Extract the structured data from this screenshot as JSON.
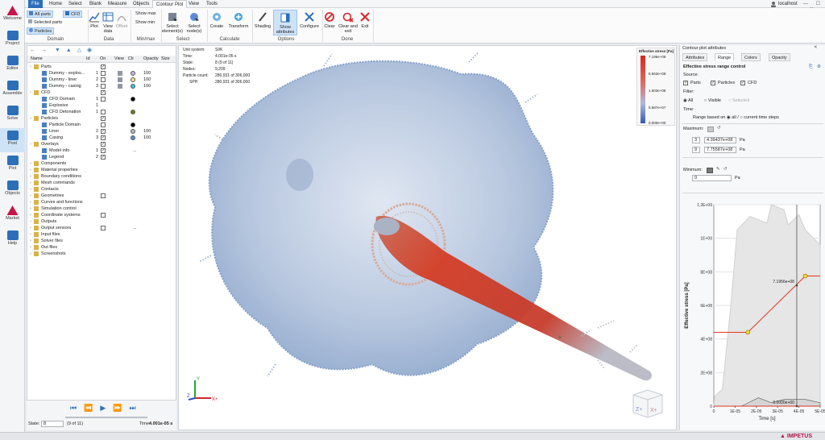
{
  "rail": [
    {
      "icon": "welcome-icon",
      "label": "Welcome",
      "active": false
    },
    {
      "icon": "project-icon",
      "label": "Project",
      "active": false
    },
    {
      "icon": "editor-icon",
      "label": "Editor",
      "active": false
    },
    {
      "icon": "assemble-icon",
      "label": "Assemble",
      "active": false
    },
    {
      "icon": "solve-icon",
      "label": "Solve",
      "active": false
    },
    {
      "icon": "post-icon",
      "label": "Post",
      "active": true
    },
    {
      "icon": "plot-icon",
      "label": "Plot",
      "active": false
    },
    {
      "icon": "objects-icon",
      "label": "Objects",
      "active": false
    },
    {
      "icon": "market-icon",
      "label": "Market",
      "active": false
    },
    {
      "icon": "help-icon",
      "label": "Help",
      "active": false
    }
  ],
  "menu": [
    "File",
    "Home",
    "Select",
    "Blank",
    "Measure",
    "Objects",
    "Contour Plot",
    "View",
    "Tools"
  ],
  "menu_active": "Contour Plot",
  "host": "localhost",
  "ribbon": {
    "domain": {
      "all_parts": "All parts",
      "cfd": "CFD",
      "selected_parts": "Selected parts",
      "particles": "Particles",
      "label": "Domain"
    },
    "data": {
      "plot": "Plot",
      "view_data": "View data",
      "offset": "Offset",
      "label": "Data"
    },
    "minmax": {
      "show_max": "Show max",
      "show_min": "Show min",
      "label": "Min/max"
    },
    "select": {
      "select_elements": "Select element(s)",
      "select_nodes": "Select node(s)",
      "label": "Select"
    },
    "calculate": {
      "create": "Create",
      "transform": "Transform",
      "label": "Calculate"
    },
    "options": {
      "shading": "Shading",
      "show_attributes": "Show attributes",
      "configure": "Configure",
      "label": "Options"
    },
    "done": {
      "clear": "Clear",
      "clear_and_exit": "Clear and exit",
      "exit": "Exit",
      "label": "Done"
    }
  },
  "tree": {
    "columns": [
      "Name",
      "Id",
      "On",
      "View",
      "Clr",
      "Opacity",
      "Size"
    ],
    "rows": [
      {
        "name": "Parts",
        "indent": 0,
        "id": "",
        "on": true,
        "clr": "",
        "opacity": "",
        "size": ""
      },
      {
        "name": "Dummy - explos...",
        "indent": 1,
        "id": "1",
        "on": false,
        "clr": "#c9b3e6",
        "opacity": "100",
        "size": ""
      },
      {
        "name": "Dummy - liner",
        "indent": 1,
        "id": "2",
        "on": false,
        "clr": "#f5e27a",
        "opacity": "100",
        "size": ""
      },
      {
        "name": "Dummy - casing",
        "indent": 1,
        "id": "3",
        "on": false,
        "clr": "#39c3dc",
        "opacity": "100",
        "size": ""
      },
      {
        "name": "CFD",
        "indent": 0,
        "id": "",
        "on": true,
        "clr": "",
        "opacity": "",
        "size": ""
      },
      {
        "name": "CFD Domain",
        "indent": 1,
        "id": "1",
        "on": false,
        "clr": "#000000",
        "opacity": "",
        "size": ""
      },
      {
        "name": "Explosive",
        "indent": 1,
        "id": "1",
        "on": null,
        "clr": "",
        "opacity": "",
        "size": ""
      },
      {
        "name": "CFD Detonation",
        "indent": 1,
        "id": "1",
        "on": false,
        "clr": "#7a7a1e",
        "opacity": "",
        "size": ""
      },
      {
        "name": "Particles",
        "indent": 0,
        "id": "",
        "on": true,
        "clr": "",
        "opacity": "",
        "size": ""
      },
      {
        "name": "Particle Domain",
        "indent": 1,
        "id": "",
        "on": false,
        "clr": "#000000",
        "opacity": "",
        "size": ""
      },
      {
        "name": "Liner",
        "indent": 1,
        "id": "2",
        "on": true,
        "clr": "#b0b8c8",
        "opacity": "100",
        "size": ""
      },
      {
        "name": "Casing",
        "indent": 1,
        "id": "3",
        "on": true,
        "clr": "#5b8bd8",
        "opacity": "100",
        "size": ""
      },
      {
        "name": "Overlays",
        "indent": 0,
        "id": "",
        "on": true,
        "clr": "",
        "opacity": "",
        "size": ""
      },
      {
        "name": "Model info",
        "indent": 1,
        "id": "1",
        "on": true,
        "clr": "",
        "opacity": "",
        "size": "..."
      },
      {
        "name": "Legend",
        "indent": 1,
        "id": "2",
        "on": true,
        "clr": "",
        "opacity": "",
        "size": ""
      },
      {
        "name": "Components",
        "indent": 0,
        "id": "",
        "on": null,
        "clr": "",
        "opacity": "",
        "size": ""
      },
      {
        "name": "Material properties",
        "indent": 0,
        "id": "",
        "on": null,
        "clr": "",
        "opacity": "",
        "size": ""
      },
      {
        "name": "Boundary conditions",
        "indent": 0,
        "id": "",
        "on": null,
        "clr": "",
        "opacity": "",
        "size": ""
      },
      {
        "name": "Mesh commands",
        "indent": 0,
        "id": "",
        "on": null,
        "clr": "",
        "opacity": "",
        "size": ""
      },
      {
        "name": "Contacts",
        "indent": 0,
        "id": "",
        "on": null,
        "clr": "",
        "opacity": "",
        "size": ""
      },
      {
        "name": "Geometries",
        "indent": 0,
        "id": "",
        "on": false,
        "clr": "",
        "opacity": "",
        "size": ""
      },
      {
        "name": "Curves and functions",
        "indent": 0,
        "id": "",
        "on": null,
        "clr": "",
        "opacity": "",
        "size": ""
      },
      {
        "name": "Simulation control",
        "indent": 0,
        "id": "",
        "on": null,
        "clr": "",
        "opacity": "",
        "size": ""
      },
      {
        "name": "Coordinate systems",
        "indent": 0,
        "id": "",
        "on": false,
        "clr": "",
        "opacity": "",
        "size": ""
      },
      {
        "name": "Outputs",
        "indent": 0,
        "id": "",
        "on": null,
        "clr": "",
        "opacity": "",
        "size": ""
      },
      {
        "name": "Output sensors",
        "indent": 0,
        "id": "",
        "on": false,
        "clr": "",
        "opacity": "",
        "size": "..."
      },
      {
        "name": "Input files",
        "indent": 0,
        "id": "",
        "on": null,
        "clr": "",
        "opacity": "",
        "size": ""
      },
      {
        "name": "Solver files",
        "indent": 0,
        "id": "",
        "on": null,
        "clr": "",
        "opacity": "",
        "size": ""
      },
      {
        "name": "Out files",
        "indent": 0,
        "id": "",
        "on": null,
        "clr": "",
        "opacity": "",
        "size": ""
      },
      {
        "name": "Screenshots",
        "indent": 0,
        "id": "",
        "on": null,
        "clr": "",
        "opacity": "",
        "size": ""
      }
    ]
  },
  "playback": {
    "state_label": "State:",
    "state_value": "8",
    "state_of": "(9 of 11)",
    "time_label": "Time:",
    "time_value": "4.001e-05 s"
  },
  "model_info": [
    {
      "k": "Unit system:",
      "v": "SI/K"
    },
    {
      "k": "Time:",
      "v": "4.001e-05 s"
    },
    {
      "k": "State:",
      "v": "8 (9 of 11)"
    },
    {
      "k": "Nodes:",
      "v": "9,209"
    },
    {
      "k": "Particle count:",
      "v": "280,931 of 306,000"
    },
    {
      "k": "SPH",
      "v": "280,931 of 306,000"
    }
  ],
  "legend": {
    "title": "Effective stress [Pa]",
    "ticks": [
      "7.196e+08",
      "5.553e+08",
      "1.603e+08",
      "5.587e+07",
      "0.000e+00"
    ]
  },
  "axes_triad": {
    "x": "X+",
    "y": "Y",
    "z": "Z"
  },
  "view_cube": {
    "face1": "Z+",
    "face2": "X+"
  },
  "rpanel": {
    "title": "Contour plot attributes",
    "tabs": [
      "Attributes",
      "Range",
      "Colors",
      "Opacity"
    ],
    "active_tab": "Range",
    "heading": "Effective stress range control",
    "source_label": "Source:",
    "sources": [
      {
        "label": "Parts",
        "checked": true
      },
      {
        "label": "Particles",
        "checked": true
      },
      {
        "label": "CFD",
        "checked": true
      }
    ],
    "filter_label": "Filter:",
    "filters": [
      "All",
      "Visible",
      "Selected"
    ],
    "filter_selected": "All",
    "time_label": "Time:",
    "range_based_on": "Range based on",
    "range_all": "all",
    "range_sep": "/",
    "range_current": "current time steps",
    "maximum_label": "Maximum:",
    "max_rows": [
      {
        "idx": "3",
        "value": "4.39437e+08",
        "unit": "Pa"
      },
      {
        "idx": "9",
        "value": "7.75587e+08",
        "unit": "Pa"
      }
    ],
    "minimum_label": "Minimum:",
    "min_row": {
      "value": "0",
      "unit": "Pa"
    }
  },
  "chart_data": {
    "type": "line",
    "xlabel": "Time [s]",
    "ylabel": "Effective stress [Pa]",
    "xlim": [
      0,
      5e-05
    ],
    "ylim": [
      0,
      1200000000
    ],
    "x_ticks": [
      "0",
      "1E-05",
      "2E-05",
      "3E-05",
      "4E-05",
      "5E-05"
    ],
    "y_ticks": [
      "0",
      "2E+08",
      "4E+08",
      "6E+08",
      "8E+08",
      "1E+09",
      "1.2E+09"
    ],
    "series": [
      {
        "values": [
          [
            0,
            440000000
          ],
          [
            1.6e-05,
            440000000
          ],
          [
            4.3e-05,
            775000000
          ],
          [
            5e-05,
            775000000
          ]
        ],
        "color": "#e0341e"
      },
      {
        "values": [
          [
            0,
            0
          ],
          [
            1.6e-05,
            0
          ],
          [
            5e-05,
            0
          ]
        ],
        "color": "#e0341e"
      }
    ],
    "envelope": [
      [
        0,
        0
      ],
      [
        5e-07,
        60000000
      ],
      [
        4e-06,
        100000000
      ],
      [
        8e-06,
        600000000
      ],
      [
        1.1e-05,
        1050000000
      ],
      [
        1.7e-05,
        1130000000
      ],
      [
        2.5e-05,
        1090000000
      ],
      [
        2.7e-05,
        1200000000
      ],
      [
        3.3e-05,
        1170000000
      ],
      [
        3.5e-05,
        1080000000
      ],
      [
        4e-05,
        1140000000
      ],
      [
        4.3e-05,
        1050000000
      ],
      [
        5e-05,
        960000000
      ]
    ],
    "low_envelope": [
      [
        0,
        0
      ],
      [
        1.3e-05,
        0
      ],
      [
        2.1e-05,
        50000000
      ],
      [
        2.7e-05,
        20000000
      ],
      [
        3.3e-05,
        40000000
      ],
      [
        4.3e-05,
        40000000
      ],
      [
        5e-05,
        20000000
      ]
    ],
    "markers": [
      [
        1.6e-05,
        440000000
      ],
      [
        4.3e-05,
        775000000
      ]
    ],
    "cursor_x": 3.9e-05,
    "annotations": [
      {
        "text": "7.1956e+08",
        "x": 3.9e-05,
        "y": 719560000
      },
      {
        "text": "0.0000e+00",
        "x": 3.9e-05,
        "y": 0
      }
    ]
  }
}
